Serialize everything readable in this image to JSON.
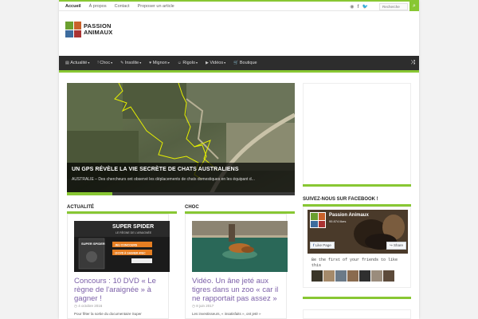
{
  "topbar": {
    "nav": [
      "Accueil",
      "À propos",
      "Contact",
      "Proposer un article"
    ],
    "social_icons": [
      "rss-icon",
      "facebook-icon",
      "twitter-icon"
    ],
    "search_placeholder": "Recherche",
    "search_icon": "search-icon"
  },
  "logo": {
    "line1": "PASSION",
    "line2": "ANIMAUX"
  },
  "mainnav": {
    "items": [
      {
        "icon": "▤",
        "icon_name": "newspaper-icon",
        "label": "Actualité",
        "has_dropdown": true
      },
      {
        "icon": "!",
        "icon_name": "exclamation-icon",
        "label": "Choc",
        "has_dropdown": true
      },
      {
        "icon": "✎",
        "icon_name": "pencil-icon",
        "label": "Insolite",
        "has_dropdown": true
      },
      {
        "icon": "♥",
        "icon_name": "heart-icon",
        "label": "Mignon",
        "has_dropdown": true
      },
      {
        "icon": "☺",
        "icon_name": "smile-icon",
        "label": "Rigolo",
        "has_dropdown": true
      },
      {
        "icon": "▶",
        "icon_name": "video-icon",
        "label": "Vidéos",
        "has_dropdown": true
      },
      {
        "icon": "🛒",
        "icon_name": "cart-icon",
        "label": "Boutique",
        "has_dropdown": false
      }
    ],
    "caret": "▾",
    "shuffle_icon": "⤨"
  },
  "slider": {
    "title": "Un GPS révèle la vie secrète de chats australiens",
    "excerpt": "AUSTRALIE – Des chercheurs ont observé les déplacements de chats domestiques en les équipant d...",
    "progress": 0.2
  },
  "columns": [
    {
      "heading": "Actualité",
      "post": {
        "title": "Concours : 10 DVD « Le règne de l'araignée » à gagner !",
        "date": "4 octobre 2016",
        "excerpt": "Pour fêter la sortie du documentaire Super",
        "thumb": {
          "headline": "SUPER SPIDER",
          "sub": "LE RÈGNE DE L'ARAIGNÉE",
          "dvd_title": "SUPER SPIDER",
          "badge1": "JEU CONCOURS",
          "badge2": "10 DVD À GAGNER AVEC"
        }
      }
    },
    {
      "heading": "Choc",
      "post": {
        "title": "Vidéo. Un âne jeté aux tigres dans un zoo « car il ne rapportait pas assez »",
        "date": "8 juin 2017",
        "excerpt": "Les investisseurs, « insatisfaits », ont jeté »"
      }
    }
  ],
  "sidebar": {
    "facebook_title": "Suivez-nous sur Facebook !",
    "page_name": "Passion Animaux",
    "likes": "95 874 likes",
    "like_button": "Like Page",
    "share_button": "Share",
    "friends_text": "Be the first of your friends to like this"
  },
  "colors": {
    "accent": "#88c733",
    "nav_bg": "#2d2d2d",
    "post_title": "#7b5fa8"
  }
}
